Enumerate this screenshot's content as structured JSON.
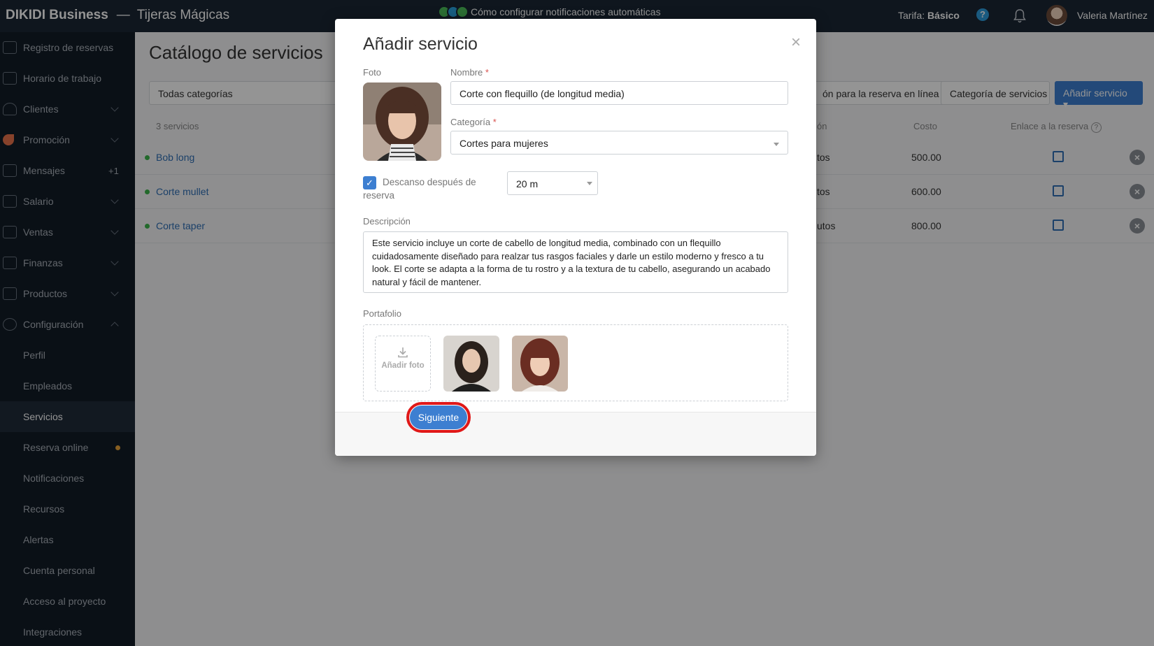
{
  "topbar": {
    "brand": "DIKIDI Business",
    "separator": "—",
    "business_name": "Tijeras Mágicas",
    "notice": "Cómo configurar notificaciones automáticas",
    "tarifa_label": "Tarifa:",
    "tarifa_value": "Básico",
    "help": "?",
    "user_name": "Valeria Martínez"
  },
  "sidebar": {
    "items": [
      {
        "label": "Registro de reservas",
        "icon": "book-icon"
      },
      {
        "label": "Horario de trabajo",
        "icon": "calendar-icon"
      },
      {
        "label": "Clientes",
        "icon": "users-icon"
      },
      {
        "label": "Promoción",
        "icon": "rocket-icon"
      },
      {
        "label": "Mensajes",
        "icon": "message-icon",
        "badge": "+1"
      },
      {
        "label": "Salario",
        "icon": "table-icon"
      },
      {
        "label": "Ventas",
        "icon": "receipt-icon"
      },
      {
        "label": "Finanzas",
        "icon": "money-icon"
      },
      {
        "label": "Productos",
        "icon": "cart-icon"
      },
      {
        "label": "Configuración",
        "icon": "gear-icon"
      },
      {
        "label": "Perfil"
      },
      {
        "label": "Empleados"
      },
      {
        "label": "Servicios"
      },
      {
        "label": "Reserva online"
      },
      {
        "label": "Notificaciones"
      },
      {
        "label": "Recursos"
      },
      {
        "label": "Alertas"
      },
      {
        "label": "Cuenta personal"
      },
      {
        "label": "Acceso al proyecto"
      },
      {
        "label": "Integraciones"
      }
    ]
  },
  "main": {
    "title": "Catálogo de servicios",
    "filter": "Todas categorías",
    "btn_online": "ón para la reserva en línea",
    "btn_category": "Categoría de servicios",
    "btn_add": "Añadir servicio ▾",
    "count": "3 servicios",
    "col_duration": "ón",
    "col_cost": "Costo",
    "col_link": "Enlace a la reserva",
    "rows": [
      {
        "name": "Bob long",
        "duration": "tos",
        "cost": "500.00"
      },
      {
        "name": "Corte mullet",
        "duration": "tos",
        "cost": "600.00"
      },
      {
        "name": "Corte taper",
        "duration": "utos",
        "cost": "800.00"
      }
    ]
  },
  "modal": {
    "title": "Añadir servicio",
    "close": "×",
    "photo_label": "Foto",
    "name_label": "Nombre",
    "name_value": "Corte con flequillo (de longitud media)",
    "category_label": "Categoría",
    "category_value": "Cortes para mujeres",
    "break_label": "Descanso después de reserva",
    "break_value": "20 m",
    "desc_label": "Descripción",
    "desc_value": "Este servicio incluye un corte de cabello de longitud media, combinado con un flequillo cuidadosamente diseñado para realzar tus rasgos faciales y darle un estilo moderno y fresco a tu look. El corte se adapta a la forma de tu rostro y a la textura de tu cabello, asegurando un acabado natural y fácil de mantener.",
    "portfolio_label": "Portafolio",
    "add_photo": "Añadir foto",
    "next_button": "Siguiente"
  }
}
